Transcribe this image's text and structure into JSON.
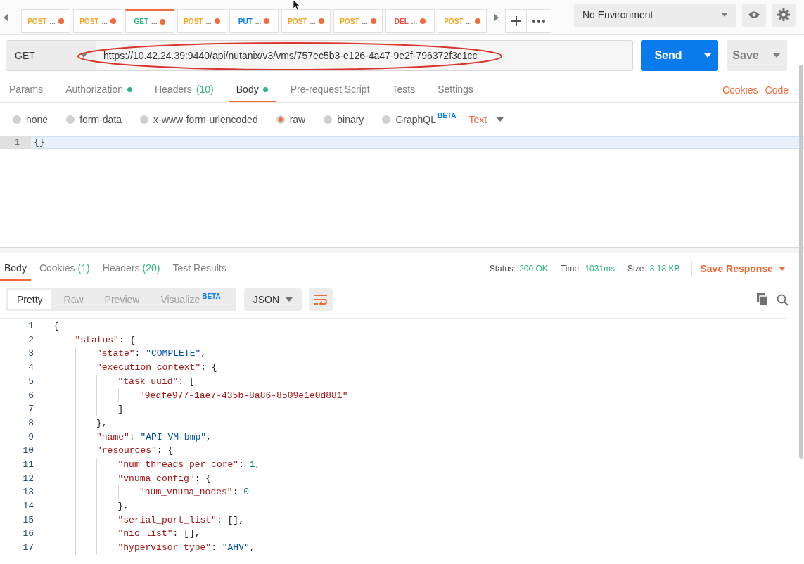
{
  "request_tabs": [
    {
      "method": "POST",
      "title": "...",
      "color": "#f5a623",
      "selected": false,
      "unsaved": true
    },
    {
      "method": "POST",
      "title": "...",
      "color": "#f5a623",
      "selected": false,
      "unsaved": true
    },
    {
      "method": "GET",
      "title": "...",
      "color": "#2eb37c",
      "selected": true,
      "unsaved": true
    },
    {
      "method": "POST",
      "title": "...",
      "color": "#f5a623",
      "selected": false,
      "unsaved": true
    },
    {
      "method": "PUT",
      "title": "...",
      "color": "#097bed",
      "selected": false,
      "unsaved": true
    },
    {
      "method": "POST",
      "title": "...",
      "color": "#f5a623",
      "selected": false,
      "unsaved": true
    },
    {
      "method": "POST",
      "title": "...",
      "color": "#f5a623",
      "selected": false,
      "unsaved": true
    },
    {
      "method": "DEL",
      "title": "...",
      "color": "#ed4b48",
      "selected": false,
      "unsaved": true
    },
    {
      "method": "POST",
      "title": "...",
      "color": "#f5a623",
      "selected": false,
      "unsaved": true
    }
  ],
  "environment": {
    "value": "No Environment"
  },
  "request": {
    "method": "GET",
    "url": "https://10.42.24.39:9440/api/nutanix/v3/vms/757ec5b3-e126-4a47-9e2f-796372f3c1cc",
    "send": "Send",
    "save": "Save",
    "highlighted": true
  },
  "request_sections": [
    {
      "label": "Params",
      "selected": false
    },
    {
      "label": "Authorization",
      "selected": false,
      "dot": true
    },
    {
      "label": "Headers",
      "count": "(10)",
      "selected": false
    },
    {
      "label": "Body",
      "selected": true,
      "dot": true
    },
    {
      "label": "Pre-request Script",
      "selected": false
    },
    {
      "label": "Tests",
      "selected": false
    },
    {
      "label": "Settings",
      "selected": false
    }
  ],
  "request_links": [
    "Cookies",
    "Code"
  ],
  "body_types": [
    {
      "label": "none",
      "selected": false
    },
    {
      "label": "form-data",
      "selected": false
    },
    {
      "label": "x-www-form-urlencoded",
      "selected": false
    },
    {
      "label": "raw",
      "selected": true
    },
    {
      "label": "binary",
      "selected": false
    },
    {
      "label": "GraphQL",
      "badge": "BETA",
      "selected": false
    }
  ],
  "body_format": "Text",
  "body_editor": {
    "lines": [
      {
        "number": "1",
        "text": "{}"
      }
    ]
  },
  "response_sections": [
    {
      "label": "Body",
      "selected": true
    },
    {
      "label": "Cookies",
      "count": "(1)",
      "selected": false
    },
    {
      "label": "Headers",
      "count": "(20)",
      "selected": false
    },
    {
      "label": "Test Results",
      "selected": false
    }
  ],
  "response_meta": [
    {
      "label": "Status:",
      "value": "200 OK"
    },
    {
      "label": "Time:",
      "value": "1031ms"
    },
    {
      "label": "Size:",
      "value": "3.18 KB"
    }
  ],
  "save_response": "Save Response",
  "view_modes": [
    {
      "label": "Pretty",
      "selected": true
    },
    {
      "label": "Raw",
      "selected": false
    },
    {
      "label": "Preview",
      "selected": false
    },
    {
      "label": "Visualize",
      "badge": "BETA",
      "selected": false
    }
  ],
  "response_format": "JSON",
  "wrap_lines": {
    "on": true
  },
  "response_code": [
    {
      "number": "1",
      "tokens": [
        {
          "kind": "punct",
          "text": "{"
        }
      ],
      "children": [
        {
          "number": "2",
          "tokens": [
            {
              "kind": "key",
              "text": "\"status\""
            },
            {
              "kind": "punct",
              "text": ": {"
            }
          ],
          "children": [
            {
              "number": "3",
              "tokens": [
                {
                  "kind": "key",
                  "text": "\"state\""
                },
                {
                  "kind": "punct",
                  "text": ": "
                },
                {
                  "kind": "string",
                  "text": "\"COMPLETE\""
                },
                {
                  "kind": "punct",
                  "text": ","
                }
              ]
            },
            {
              "number": "4",
              "tokens": [
                {
                  "kind": "key",
                  "text": "\"execution_context\""
                },
                {
                  "kind": "punct",
                  "text": ": {"
                }
              ],
              "children": [
                {
                  "number": "5",
                  "tokens": [
                    {
                      "kind": "key",
                      "text": "\"task_uuid\""
                    },
                    {
                      "kind": "punct",
                      "text": ": ["
                    }
                  ],
                  "children": [
                    {
                      "number": "6",
                      "tokens": [
                        {
                          "kind": "key",
                          "text": "\"9edfe977-1ae7-435b-8a86-8509e1e0d881\""
                        }
                      ]
                    }
                  ]
                },
                {
                  "number": "7",
                  "tokens": [
                    {
                      "kind": "punct",
                      "text": "]"
                    }
                  ]
                }
              ]
            },
            {
              "number": "8",
              "tokens": [
                {
                  "kind": "punct",
                  "text": "},"
                }
              ]
            },
            {
              "number": "9",
              "tokens": [
                {
                  "kind": "key",
                  "text": "\"name\""
                },
                {
                  "kind": "punct",
                  "text": ": "
                },
                {
                  "kind": "string",
                  "text": "\"API-VM-bmp\""
                },
                {
                  "kind": "punct",
                  "text": ","
                }
              ]
            },
            {
              "number": "10",
              "tokens": [
                {
                  "kind": "key",
                  "text": "\"resources\""
                },
                {
                  "kind": "punct",
                  "text": ": {"
                }
              ],
              "children": [
                {
                  "number": "11",
                  "tokens": [
                    {
                      "kind": "key",
                      "text": "\"num_threads_per_core\""
                    },
                    {
                      "kind": "punct",
                      "text": ": "
                    },
                    {
                      "kind": "number",
                      "text": "1"
                    },
                    {
                      "kind": "punct",
                      "text": ","
                    }
                  ]
                },
                {
                  "number": "12",
                  "tokens": [
                    {
                      "kind": "key",
                      "text": "\"vnuma_config\""
                    },
                    {
                      "kind": "punct",
                      "text": ": {"
                    }
                  ],
                  "children": [
                    {
                      "number": "13",
                      "tokens": [
                        {
                          "kind": "key",
                          "text": "\"num_vnuma_nodes\""
                        },
                        {
                          "kind": "punct",
                          "text": ": "
                        },
                        {
                          "kind": "number",
                          "text": "0"
                        }
                      ]
                    }
                  ]
                },
                {
                  "number": "14",
                  "tokens": [
                    {
                      "kind": "punct",
                      "text": "},"
                    }
                  ]
                },
                {
                  "number": "15",
                  "tokens": [
                    {
                      "kind": "key",
                      "text": "\"serial_port_list\""
                    },
                    {
                      "kind": "punct",
                      "text": ": [],"
                    }
                  ]
                },
                {
                  "number": "16",
                  "tokens": [
                    {
                      "kind": "key",
                      "text": "\"nic_list\""
                    },
                    {
                      "kind": "punct",
                      "text": ": [],"
                    }
                  ]
                },
                {
                  "number": "17",
                  "tokens": [
                    {
                      "kind": "key",
                      "text": "\"hypervisor_type\""
                    },
                    {
                      "kind": "punct",
                      "text": ": "
                    },
                    {
                      "kind": "string",
                      "text": "\"AHV\""
                    },
                    {
                      "kind": "punct",
                      "text": ","
                    }
                  ]
                }
              ]
            }
          ]
        }
      ]
    }
  ]
}
